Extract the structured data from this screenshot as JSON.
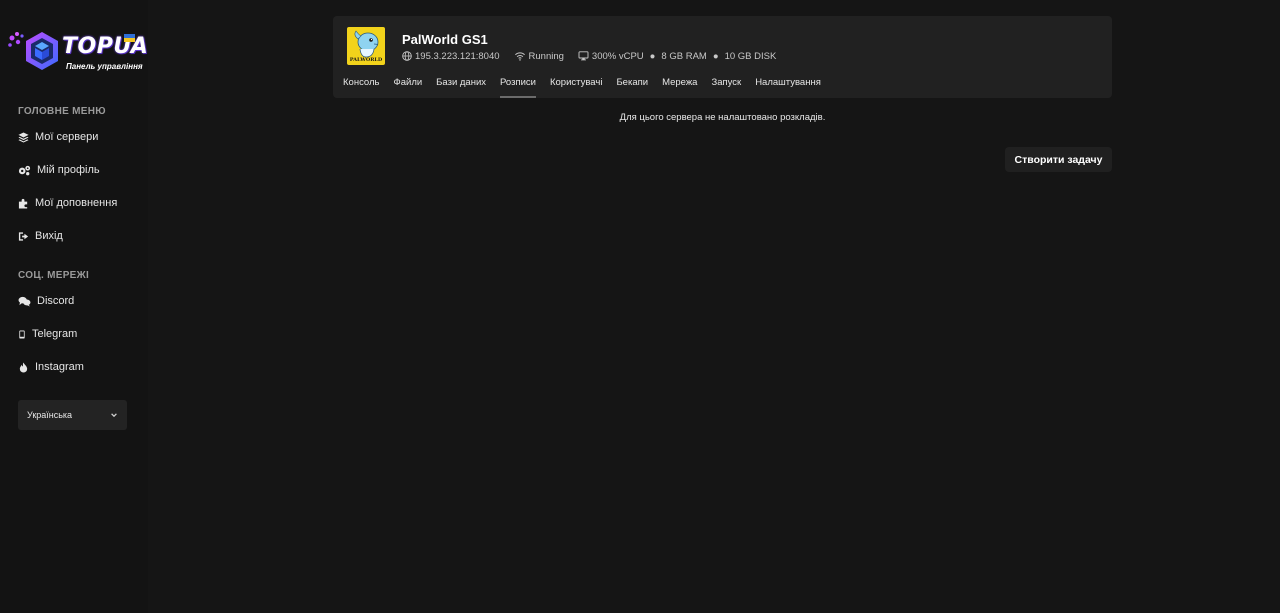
{
  "brand": {
    "name": "TOPUA",
    "subtitle": "Панель управління",
    "flag_colors": [
      "#2f6fd6",
      "#f3c623"
    ]
  },
  "sidebar": {
    "main_menu_title": "ГОЛОВНЕ МЕНЮ",
    "main_items": [
      {
        "label": "Мої сервери",
        "icon": "layers-icon"
      },
      {
        "label": "Мій профіль",
        "icon": "gears-icon"
      },
      {
        "label": "Мої доповнення",
        "icon": "puzzle-icon"
      },
      {
        "label": "Вихід",
        "icon": "logout-icon"
      }
    ],
    "social_title": "СОЦ. МЕРЕЖІ",
    "social_items": [
      {
        "label": "Discord",
        "icon": "chat-icon"
      },
      {
        "label": "Telegram",
        "icon": "phone-icon"
      },
      {
        "label": "Instagram",
        "icon": "flame-icon"
      }
    ],
    "language": {
      "selected": "Українська"
    }
  },
  "server": {
    "name": "PalWorld GS1",
    "icon_label": "PALWORLD",
    "address": "195.3.223.121:8040",
    "status": "Running",
    "cpu": "300% vCPU",
    "ram": "8 GB RAM",
    "disk": "10 GB DISK",
    "separator": "●",
    "icon_color": "#f2d31b"
  },
  "tabs": [
    {
      "label": "Консоль",
      "active": false
    },
    {
      "label": "Файли",
      "active": false
    },
    {
      "label": "Бази даних",
      "active": false
    },
    {
      "label": "Розписи",
      "active": true
    },
    {
      "label": "Користувачі",
      "active": false
    },
    {
      "label": "Бекапи",
      "active": false
    },
    {
      "label": "Мережа",
      "active": false
    },
    {
      "label": "Запуск",
      "active": false
    },
    {
      "label": "Налаштування",
      "active": false
    }
  ],
  "main": {
    "empty_message": "Для цього сервера не налаштовано розкладів.",
    "create_button": "Створити задачу"
  }
}
